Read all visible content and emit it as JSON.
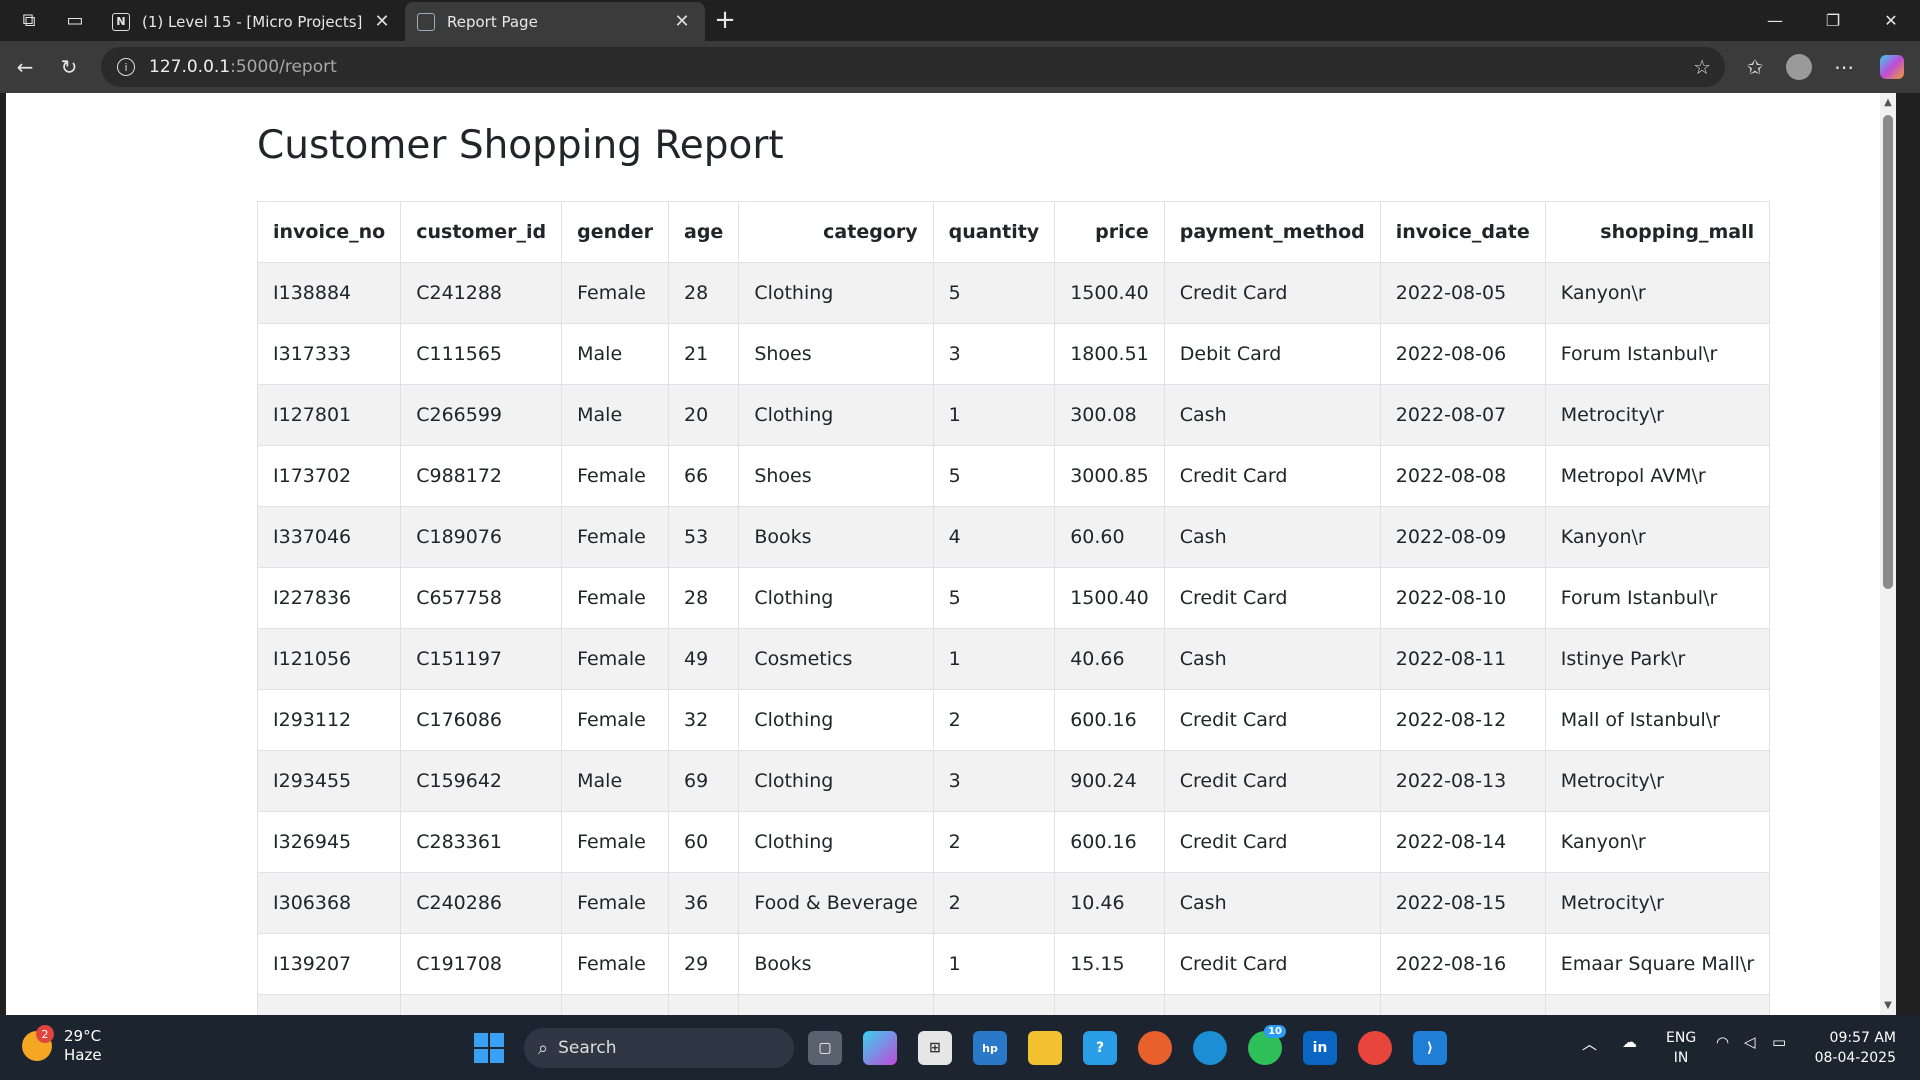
{
  "browser": {
    "tabs": [
      {
        "title": "(1) Level 15 - [Micro Projects]",
        "icon": "notion-icon"
      },
      {
        "title": "Report Page",
        "icon": "terminal-icon"
      }
    ],
    "url_host": "127.0.0.1",
    "url_path": ":5000/report"
  },
  "page": {
    "title": "Customer Shopping Report",
    "columns": [
      "invoice_no",
      "customer_id",
      "gender",
      "age",
      "category",
      "quantity",
      "price",
      "payment_method",
      "invoice_date",
      "shopping_mall"
    ],
    "rows": [
      [
        "I138884",
        "C241288",
        "Female",
        "28",
        "Clothing",
        "5",
        "1500.40",
        "Credit Card",
        "2022-08-05",
        "Kanyon\\r"
      ],
      [
        "I317333",
        "C111565",
        "Male",
        "21",
        "Shoes",
        "3",
        "1800.51",
        "Debit Card",
        "2022-08-06",
        "Forum Istanbul\\r"
      ],
      [
        "I127801",
        "C266599",
        "Male",
        "20",
        "Clothing",
        "1",
        "300.08",
        "Cash",
        "2022-08-07",
        "Metrocity\\r"
      ],
      [
        "I173702",
        "C988172",
        "Female",
        "66",
        "Shoes",
        "5",
        "3000.85",
        "Credit Card",
        "2022-08-08",
        "Metropol AVM\\r"
      ],
      [
        "I337046",
        "C189076",
        "Female",
        "53",
        "Books",
        "4",
        "60.60",
        "Cash",
        "2022-08-09",
        "Kanyon\\r"
      ],
      [
        "I227836",
        "C657758",
        "Female",
        "28",
        "Clothing",
        "5",
        "1500.40",
        "Credit Card",
        "2022-08-10",
        "Forum Istanbul\\r"
      ],
      [
        "I121056",
        "C151197",
        "Female",
        "49",
        "Cosmetics",
        "1",
        "40.66",
        "Cash",
        "2022-08-11",
        "Istinye Park\\r"
      ],
      [
        "I293112",
        "C176086",
        "Female",
        "32",
        "Clothing",
        "2",
        "600.16",
        "Credit Card",
        "2022-08-12",
        "Mall of Istanbul\\r"
      ],
      [
        "I293455",
        "C159642",
        "Male",
        "69",
        "Clothing",
        "3",
        "900.24",
        "Credit Card",
        "2022-08-13",
        "Metrocity\\r"
      ],
      [
        "I326945",
        "C283361",
        "Female",
        "60",
        "Clothing",
        "2",
        "600.16",
        "Credit Card",
        "2022-08-14",
        "Kanyon\\r"
      ],
      [
        "I306368",
        "C240286",
        "Female",
        "36",
        "Food & Beverage",
        "2",
        "10.46",
        "Cash",
        "2022-08-15",
        "Metrocity\\r"
      ],
      [
        "I139207",
        "C191708",
        "Female",
        "29",
        "Books",
        "1",
        "15.15",
        "Credit Card",
        "2022-08-16",
        "Emaar Square Mall\\r"
      ],
      [
        "",
        "",
        "",
        "",
        "",
        "",
        "",
        "",
        "",
        ""
      ]
    ]
  },
  "taskbar": {
    "weather_temp": "29°C",
    "weather_desc": "Haze",
    "weather_badge": "2",
    "search_label": "Search",
    "whatsapp_count": "10",
    "lang_top": "ENG",
    "lang_bottom": "IN",
    "time": "09:57 AM",
    "date": "08-04-2025"
  }
}
